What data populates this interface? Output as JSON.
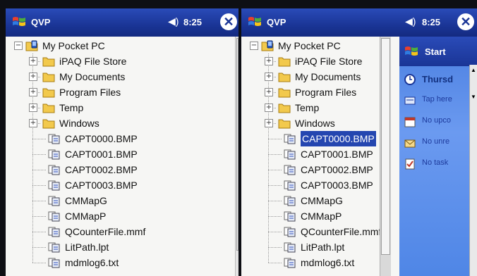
{
  "colors": {
    "titlebar": "#1a3596",
    "selection": "#2446b0",
    "folder": "#f2c94c"
  },
  "left": {
    "app_title": "QVP",
    "time": "8:25",
    "close_glyph": "✕",
    "root": "My Pocket PC",
    "folders": [
      "iPAQ File Store",
      "My Documents",
      "Program Files",
      "Temp",
      "Windows"
    ],
    "files": [
      "CAPT0000.BMP",
      "CAPT0001.BMP",
      "CAPT0002.BMP",
      "CAPT0003.BMP",
      "CMMapG",
      "CMMapP",
      "QCounterFile.mmf",
      "LitPath.lpt",
      "mdmlog6.txt"
    ]
  },
  "right": {
    "app_title": "QVP",
    "time": "8:25",
    "close_glyph": "✕",
    "root": "My Pocket PC",
    "folders": [
      "iPAQ File Store",
      "My Documents",
      "Program Files",
      "Temp",
      "Windows"
    ],
    "files": [
      "CAPT0000.BMP",
      "CAPT0001.BMP",
      "CAPT0002.BMP",
      "CAPT0003.BMP",
      "CMMapG",
      "CMMapP",
      "QCounterFile.mmf",
      "LitPath.lpt",
      "mdmlog6.txt"
    ],
    "selected_file": "CAPT0000.BMP"
  },
  "today": {
    "start_label": "Start",
    "date": "Thursd",
    "items": [
      "Tap here",
      "No upco",
      "No unre",
      "No task"
    ]
  }
}
